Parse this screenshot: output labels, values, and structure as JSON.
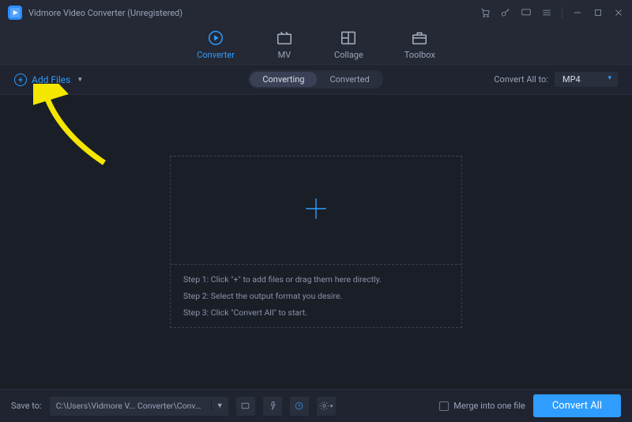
{
  "titlebar": {
    "title": "Vidmore Video Converter (Unregistered)"
  },
  "tabs": {
    "converter": "Converter",
    "mv": "MV",
    "collage": "Collage",
    "toolbox": "Toolbox"
  },
  "subbar": {
    "add_files": "Add Files",
    "converting": "Converting",
    "converted": "Converted",
    "convert_all_to": "Convert All to:",
    "format": "MP4"
  },
  "dropzone": {
    "step1": "Step 1: Click \"+\" to add files or drag them here directly.",
    "step2": "Step 2: Select the output format you desire.",
    "step3": "Step 3: Click \"Convert All\" to start."
  },
  "bottombar": {
    "save_to": "Save to:",
    "path": "C:\\Users\\Vidmore V... Converter\\Converted",
    "merge": "Merge into one file",
    "convert_all": "Convert All"
  }
}
